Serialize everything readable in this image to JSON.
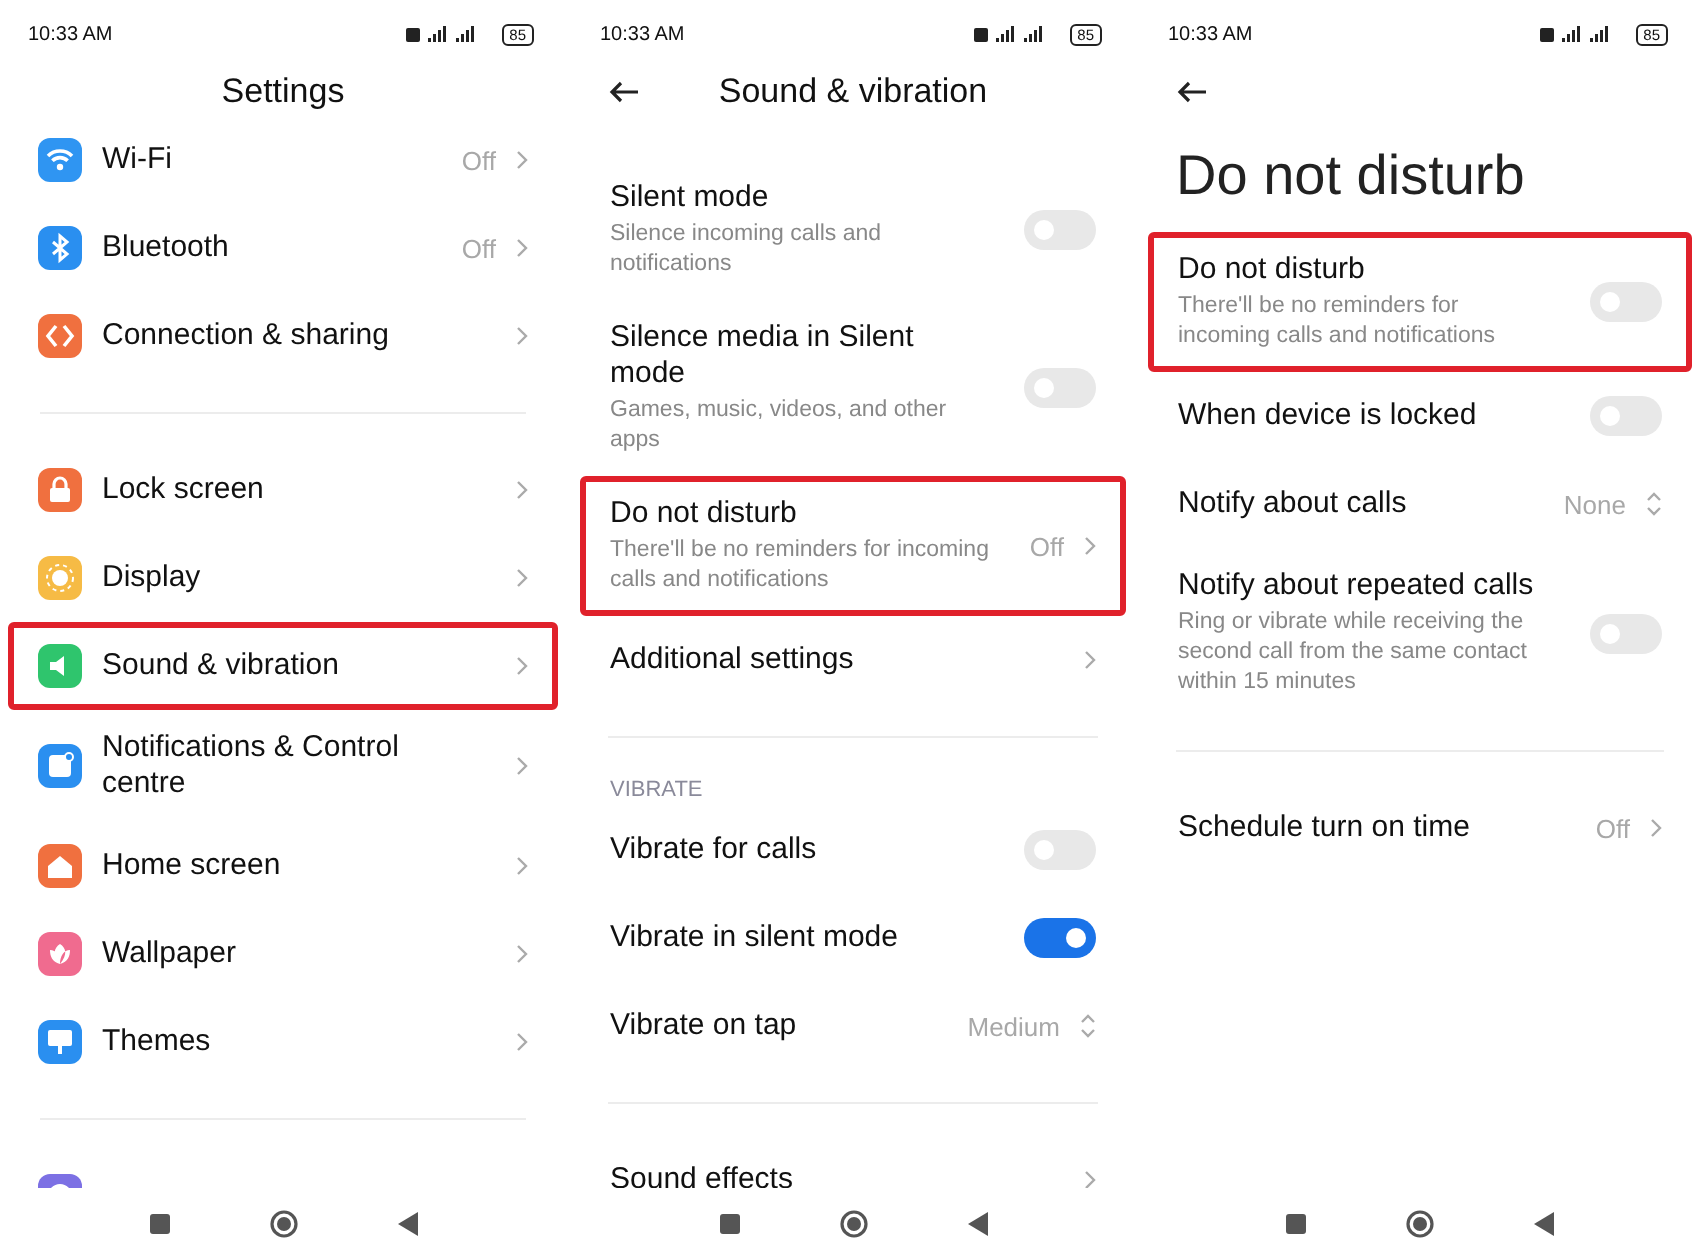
{
  "screens": [
    {
      "status": {
        "time": "10:33 AM",
        "battery": "85"
      },
      "header": {
        "kind": "center",
        "back": false,
        "title": "Settings"
      },
      "sections": [
        {
          "items": [
            {
              "kind": "link",
              "title": "Wi-Fi",
              "value": "Off",
              "color": "#2f95f2",
              "highlighted": false
            },
            {
              "kind": "link",
              "title": "Bluetooth",
              "value": "Off",
              "color": "#2a8ff0",
              "highlighted": false
            },
            {
              "kind": "link",
              "title": "Connection & sharing",
              "color": "#f0703f",
              "highlighted": false
            }
          ]
        },
        {
          "items": [
            {
              "kind": "link",
              "title": "Lock screen",
              "color": "#f0703f",
              "highlighted": false
            },
            {
              "kind": "link",
              "title": "Display",
              "color": "#f6bb45",
              "highlighted": false
            },
            {
              "kind": "link",
              "title": "Sound & vibration",
              "color": "#2fc56d",
              "highlighted": true
            },
            {
              "kind": "link",
              "title": "Notifications & Control centre",
              "color": "#2a8ff0",
              "highlighted": false
            },
            {
              "kind": "link",
              "title": "Home screen",
              "color": "#f0703f",
              "highlighted": false
            },
            {
              "kind": "link",
              "title": "Wallpaper",
              "color": "#f06b8f",
              "highlighted": false
            },
            {
              "kind": "link",
              "title": "Themes",
              "color": "#2a8ff0",
              "highlighted": false
            }
          ]
        },
        {
          "items": [
            {
              "color": "#7c70e4",
              "highlighted": false
            }
          ]
        }
      ]
    },
    {
      "status": {
        "time": "10:33 AM",
        "battery": "85"
      },
      "header": {
        "kind": "center",
        "back": true,
        "title": "Sound & vibration"
      },
      "sections": [
        {
          "items": [
            {
              "kind": "toggle",
              "title": "Silent mode",
              "subtitle": "Silence incoming calls and notifications",
              "on": false,
              "highlighted": false
            },
            {
              "kind": "toggle",
              "title": "Silence media in Silent mode",
              "subtitle": "Games, music, videos, and other apps",
              "on": false,
              "highlighted": false
            },
            {
              "kind": "link",
              "title": "Do not disturb",
              "subtitle": "There'll be no reminders for incoming calls and notifications",
              "value": "Off",
              "highlighted": true
            },
            {
              "kind": "link",
              "title": "Additional settings",
              "highlighted": false
            }
          ]
        },
        {
          "heading": "VIBRATE",
          "items": [
            {
              "kind": "toggle",
              "title": "Vibrate for calls",
              "on": false,
              "highlighted": false
            },
            {
              "kind": "toggle",
              "title": "Vibrate in silent mode",
              "on": true,
              "highlighted": false
            },
            {
              "kind": "select",
              "title": "Vibrate on tap",
              "value": "Medium",
              "highlighted": false
            }
          ]
        },
        {
          "items": [
            {
              "kind": "link",
              "title": "Sound effects",
              "highlighted": false
            }
          ]
        }
      ]
    },
    {
      "status": {
        "time": "10:33 AM",
        "battery": "85"
      },
      "header": {
        "kind": "large",
        "back": true,
        "title": "Do not disturb"
      },
      "sections": [
        {
          "items": [
            {
              "kind": "toggle",
              "title": "Do not disturb",
              "subtitle": "There'll be no reminders for incoming calls and notifications",
              "on": false,
              "highlighted": true
            },
            {
              "kind": "toggle",
              "title": "When device is locked",
              "on": false,
              "highlighted": false
            },
            {
              "kind": "select",
              "title": "Notify about calls",
              "value": "None",
              "highlighted": false
            },
            {
              "kind": "toggle",
              "title": "Notify about repeated calls",
              "subtitle": "Ring or vibrate while receiving the second call from the same contact within 15 minutes",
              "on": false,
              "highlighted": false
            }
          ]
        },
        {
          "items": [
            {
              "kind": "link",
              "title": "Schedule turn on time",
              "value": "Off",
              "highlighted": false
            }
          ]
        }
      ]
    }
  ]
}
